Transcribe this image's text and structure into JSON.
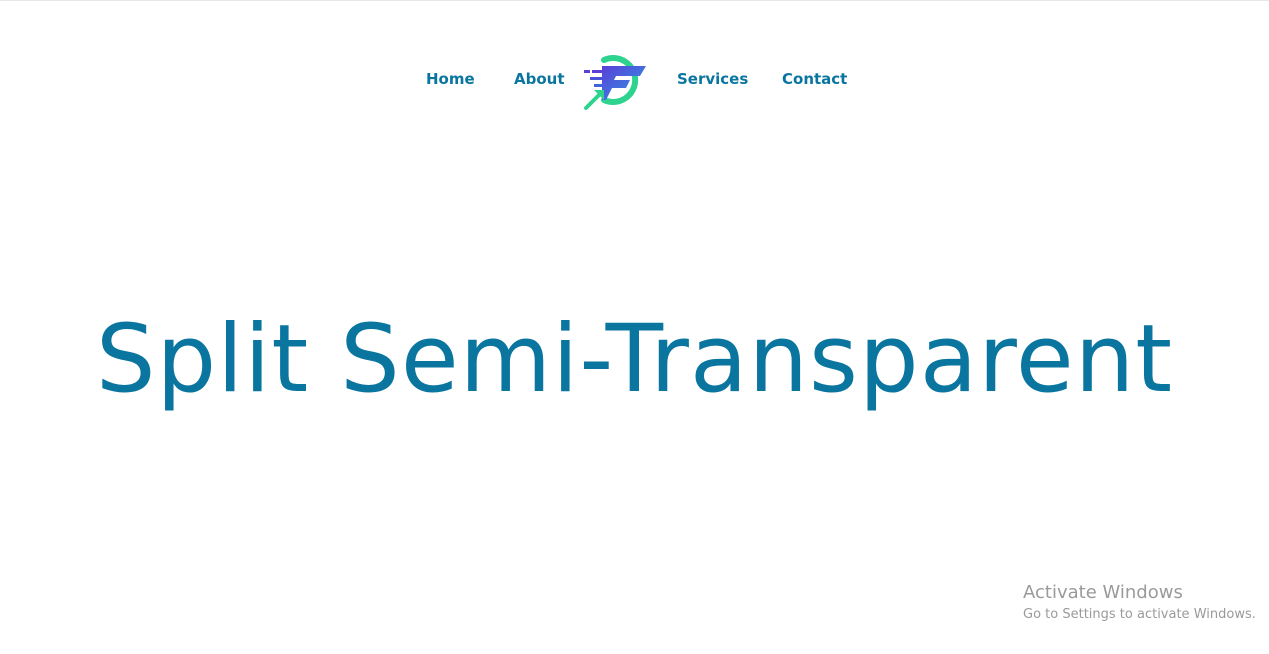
{
  "nav": {
    "items": [
      {
        "label": "Home"
      },
      {
        "label": "About"
      },
      {
        "label": "Services"
      },
      {
        "label": "Contact"
      }
    ],
    "logo_icon": "brand-logo-icon"
  },
  "hero": {
    "title": "Split Semi-Transparent"
  },
  "watermark": {
    "title": "Activate Windows",
    "subtitle": "Go to Settings to activate Windows."
  },
  "colors": {
    "primary": "#0a76a0",
    "logo_green": "#2ed38f",
    "logo_blue": "#2c6fe0",
    "logo_purple": "#5b3fd6",
    "watermark": "#9a9a9a"
  }
}
